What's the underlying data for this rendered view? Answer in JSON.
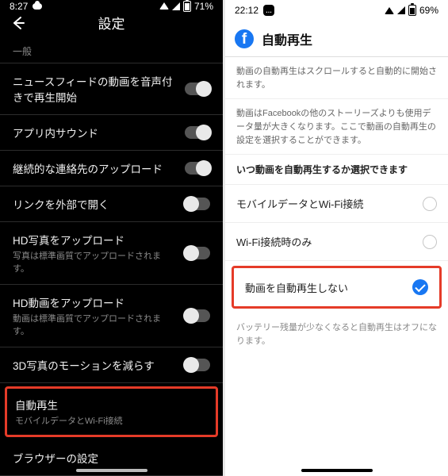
{
  "left": {
    "status": {
      "time": "8:27",
      "battery": "71%"
    },
    "header": {
      "title": "設定"
    },
    "section_label": "一般",
    "rows": [
      {
        "title": "ニュースフィードの動画を音声付きで再生開始",
        "sub": "",
        "toggle": "on"
      },
      {
        "title": "アプリ内サウンド",
        "sub": "",
        "toggle": "on"
      },
      {
        "title": "継続的な連絡先のアップロード",
        "sub": "",
        "toggle": "on"
      },
      {
        "title": "リンクを外部で開く",
        "sub": "",
        "toggle": "off"
      },
      {
        "title": "HD写真をアップロード",
        "sub": "写真は標準画質でアップロードされます。",
        "toggle": "off"
      },
      {
        "title": "HD動画をアップロード",
        "sub": "動画は標準画質でアップロードされます。",
        "toggle": "off"
      },
      {
        "title": "3D写真のモーションを減らす",
        "sub": "",
        "toggle": "off"
      }
    ],
    "highlighted": {
      "title": "自動再生",
      "sub": "モバイルデータとWi-Fi接続"
    },
    "rows_after": [
      {
        "title": "ブラウザーの設定",
        "sub": ""
      }
    ]
  },
  "right": {
    "status": {
      "time": "22:12",
      "battery": "69%"
    },
    "header": {
      "title": "自動再生"
    },
    "info1": "動画の自動再生はスクロールすると自動的に開始されます。",
    "info2": "動画はFacebookの他のストーリーズよりも使用データ量が大きくなります。ここで動画の自動再生の設定を選択することができます。",
    "section_instruction": "いつ動画を自動再生するか選択できます",
    "options": [
      {
        "label": "モバイルデータとWi-Fi接続",
        "selected": false
      },
      {
        "label": "Wi-Fi接続時のみ",
        "selected": false
      }
    ],
    "highlighted_option": {
      "label": "動画を自動再生しない",
      "selected": true
    },
    "footnote": "バッテリー残量が少なくなると自動再生はオフになります。"
  }
}
